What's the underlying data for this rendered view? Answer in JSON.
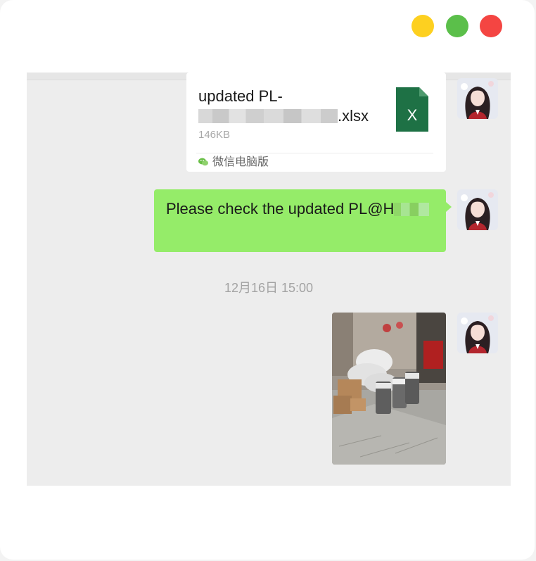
{
  "window": {
    "controls": [
      "minimize-yellow",
      "maximize-green",
      "close-red"
    ],
    "colors": {
      "yellow": "#fdd020",
      "green": "#5bbf4a",
      "red": "#f44542"
    }
  },
  "messages": {
    "file": {
      "name_line1": "updated PL-",
      "name_suffix": ".xlsx",
      "size": "146KB",
      "source": "微信电脑版",
      "icon": "excel-icon",
      "icon_letter": "X"
    },
    "text_message": {
      "text": "Please check the updated PL@H"
    },
    "timestamp": "12月16日 15:00",
    "image_message": {
      "icon": "photo"
    }
  },
  "colors": {
    "chat_background": "#ededed",
    "sent_bubble": "#95ec69",
    "excel_green": "#1e7145"
  }
}
